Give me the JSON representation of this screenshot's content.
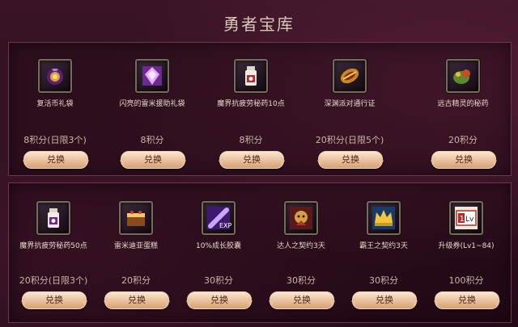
{
  "title": "勇者宝库",
  "top_items": [
    {
      "name": "复活币礼袋",
      "cost": "8积分(日限3个)",
      "button": "兑换",
      "icon": "coin-bag-icon"
    },
    {
      "name": "闪亮的雷米援助礼袋",
      "cost": "8积分",
      "button": "兑换",
      "icon": "crystal-gift-icon"
    },
    {
      "name": "魔界抗疲劳秘药10点",
      "cost": "8积分",
      "button": "兑换",
      "icon": "potion-icon"
    },
    {
      "name": "深渊派对通行证",
      "cost": "20积分(日限5个)",
      "button": "兑换",
      "icon": "ticket-icon"
    },
    {
      "name": "远古精灵的秘药",
      "cost": "20积分",
      "button": "兑换",
      "icon": "herb-potion-icon"
    }
  ],
  "bottom_items": [
    {
      "name": "魔界抗疲劳秘药50点",
      "cost": "20积分(日限3个)",
      "button": "兑换",
      "icon": "potion-icon"
    },
    {
      "name": "雷米迪亚蛋糕",
      "cost": "20积分",
      "button": "兑换",
      "icon": "cake-icon"
    },
    {
      "name": "10%成长胶囊",
      "cost": "30积分",
      "button": "兑换",
      "icon": "exp-capsule-icon"
    },
    {
      "name": "达人之契约3天",
      "cost": "30积分",
      "button": "兑换",
      "icon": "master-contract-icon"
    },
    {
      "name": "霸王之契约3天",
      "cost": "30积分",
      "button": "兑换",
      "icon": "crown-contract-icon"
    },
    {
      "name": "升级券(Lv1~84)",
      "cost": "100积分",
      "button": "兑换",
      "icon": "level-ticket-icon"
    }
  ],
  "icon_texts": {
    "exp": "EXP",
    "lv": "Lv",
    "one": "1"
  }
}
